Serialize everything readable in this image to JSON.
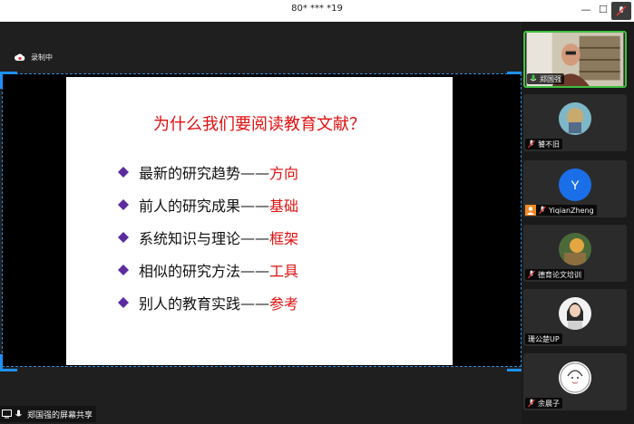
{
  "window": {
    "title": "80* *** *19"
  },
  "recording": {
    "label": "录制中"
  },
  "slide": {
    "title": "为什么我们要阅读教育文献？",
    "bullets": [
      {
        "main": "最新的研究趋势",
        "sep": "——",
        "key": "方向"
      },
      {
        "main": "前人的研究成果",
        "sep": "——",
        "key": "基础"
      },
      {
        "main": "系统知识与理论",
        "sep": "——",
        "key": "框架"
      },
      {
        "main": "相似的研究方法",
        "sep": "——",
        "key": "工具"
      },
      {
        "main": "别人的教育实践",
        "sep": "——",
        "key": "参考"
      }
    ]
  },
  "sharer": {
    "label": "郑国强的屏幕共享"
  },
  "participants": [
    {
      "name": "郑国强",
      "type": "video"
    },
    {
      "name": "饕不旧",
      "type": "avatar"
    },
    {
      "name": "YiqianZheng",
      "initial": "Y",
      "type": "initial"
    },
    {
      "name": "德育论文培训",
      "type": "avatar"
    },
    {
      "name": "珊公楚UP",
      "type": "avatar"
    },
    {
      "name": "余晨子",
      "type": "avatar"
    }
  ],
  "colors": {
    "accent": "#1e90ff",
    "slide_red": "#e01010",
    "active_border": "#3fbf3f",
    "initial_bg": "#1a6fe8"
  }
}
